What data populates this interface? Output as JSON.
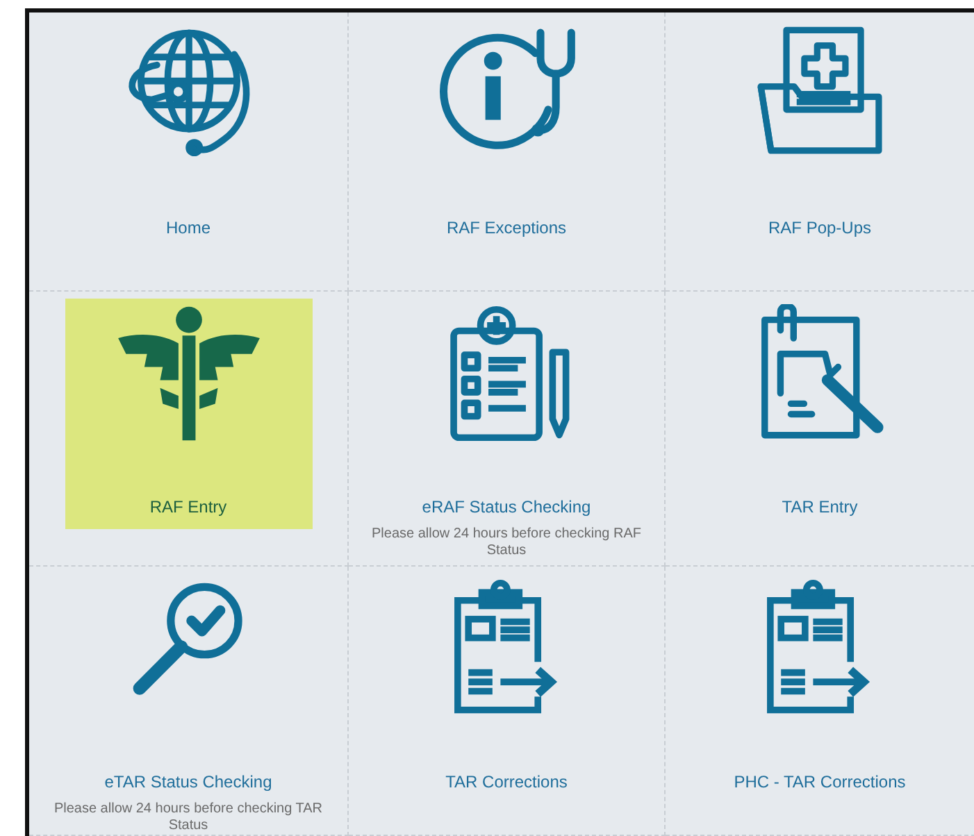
{
  "tiles": [
    {
      "label": "Home",
      "selected": false
    },
    {
      "label": "RAF Exceptions",
      "selected": false
    },
    {
      "label": "RAF Pop-Ups",
      "selected": false
    },
    {
      "label": "RAF Entry",
      "selected": true
    },
    {
      "label": "eRAF Status Checking",
      "note": "Please allow 24 hours before checking RAF Status",
      "selected": false
    },
    {
      "label": "TAR Entry",
      "selected": false
    },
    {
      "label": "eTAR Status Checking",
      "note": "Please allow 24 hours before checking TAR Status",
      "selected": false
    },
    {
      "label": "TAR Corrections",
      "selected": false
    },
    {
      "label": "PHC - TAR Corrections",
      "selected": false
    }
  ]
}
